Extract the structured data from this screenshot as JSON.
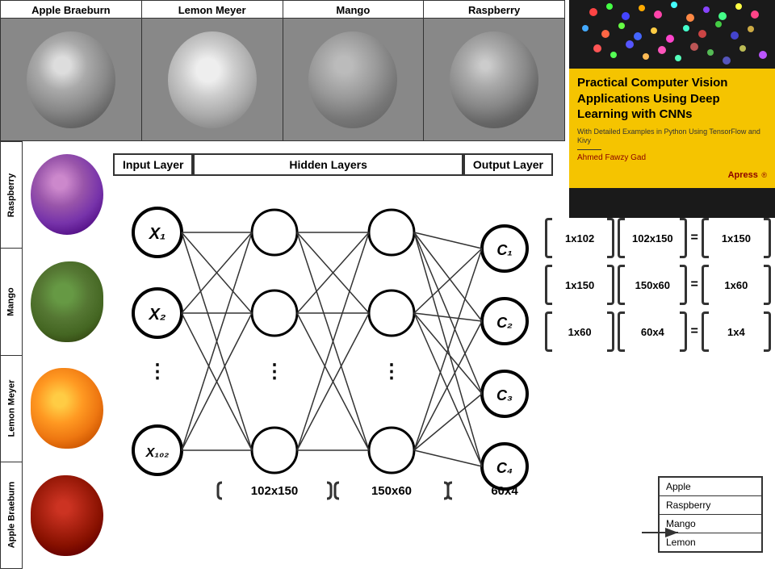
{
  "top_fruits": [
    {
      "label": "Apple Braeburn",
      "type": "apple"
    },
    {
      "label": "Lemon Meyer",
      "type": "lemon"
    },
    {
      "label": "Mango",
      "type": "mango"
    },
    {
      "label": "Raspberry",
      "type": "raspberry"
    }
  ],
  "book": {
    "title": "Practical Computer Vision Applications Using Deep Learning with CNNs",
    "subtitle": "With Detailed Examples in Python Using TensorFlow and Kivy",
    "author": "Ahmed Fawzy Gad",
    "publisher": "Apress"
  },
  "left_labels": [
    "Raspberry",
    "Mango",
    "Lemon Meyer",
    "Apple Braeburn"
  ],
  "nn_labels": {
    "input": "Input Layer",
    "hidden": "Hidden Layers",
    "output": "Output Layer"
  },
  "nn_nodes": {
    "input": [
      "X₁",
      "X₂",
      "⋮",
      "X₁₀₂"
    ],
    "output": [
      "C₁",
      "C₂",
      "C₃",
      "C₄"
    ]
  },
  "bottom_dims": [
    "102x150",
    "150x60",
    "60x4"
  ],
  "matrix_rows": [
    {
      "a": "1x102",
      "b": "102x150",
      "eq": "=",
      "c": "1x150"
    },
    {
      "a": "1x150",
      "b": "150x60",
      "eq": "=",
      "c": "1x60"
    },
    {
      "a": "1x60",
      "b": "60x4",
      "eq": "=",
      "c": "1x4"
    }
  ],
  "output_classes": [
    "Apple",
    "Raspberry",
    "Mango",
    "Lemon"
  ]
}
